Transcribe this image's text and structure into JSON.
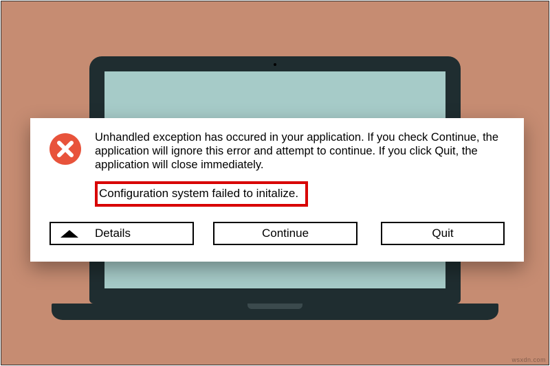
{
  "dialog": {
    "message": "Unhandled exception has occured in your application. If you check Continue, the application will ignore this error and attempt to continue. If you click Quit, the application will close immediately.",
    "error_detail": "Configuration system failed to initalize.",
    "icon": "error-x-icon",
    "buttons": {
      "details": "Details",
      "continue": "Continue",
      "quit": "Quit"
    }
  },
  "colors": {
    "background": "#c68c72",
    "laptop_bezel": "#1f2d30",
    "laptop_screen": "#a6cbc8",
    "error_icon": "#e8533b",
    "highlight_border": "#d80000"
  },
  "watermark": "wsxdn.com"
}
